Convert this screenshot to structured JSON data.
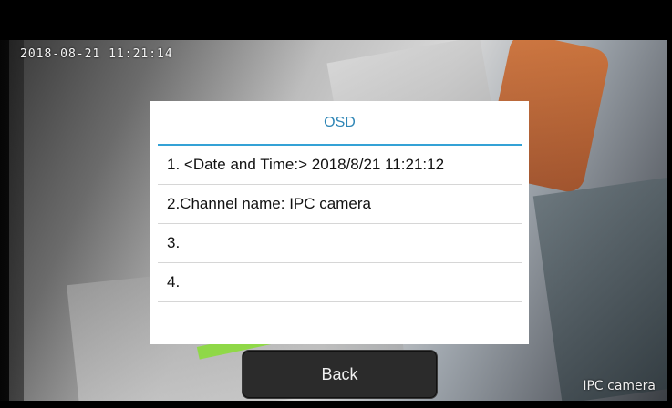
{
  "overlay": {
    "timestamp": "2018-08-21 11:21:14",
    "camera_label": "IPC camera"
  },
  "dialog": {
    "title": "OSD",
    "items": [
      {
        "label": "1. <Date and Time:> 2018/8/21 11:21:12"
      },
      {
        "label": "2.Channel name: IPC camera"
      },
      {
        "label": "3."
      },
      {
        "label": "4."
      }
    ]
  },
  "footer": {
    "back_label": "Back"
  },
  "colors": {
    "accent": "#34a2d6",
    "title": "#2f86b6"
  }
}
